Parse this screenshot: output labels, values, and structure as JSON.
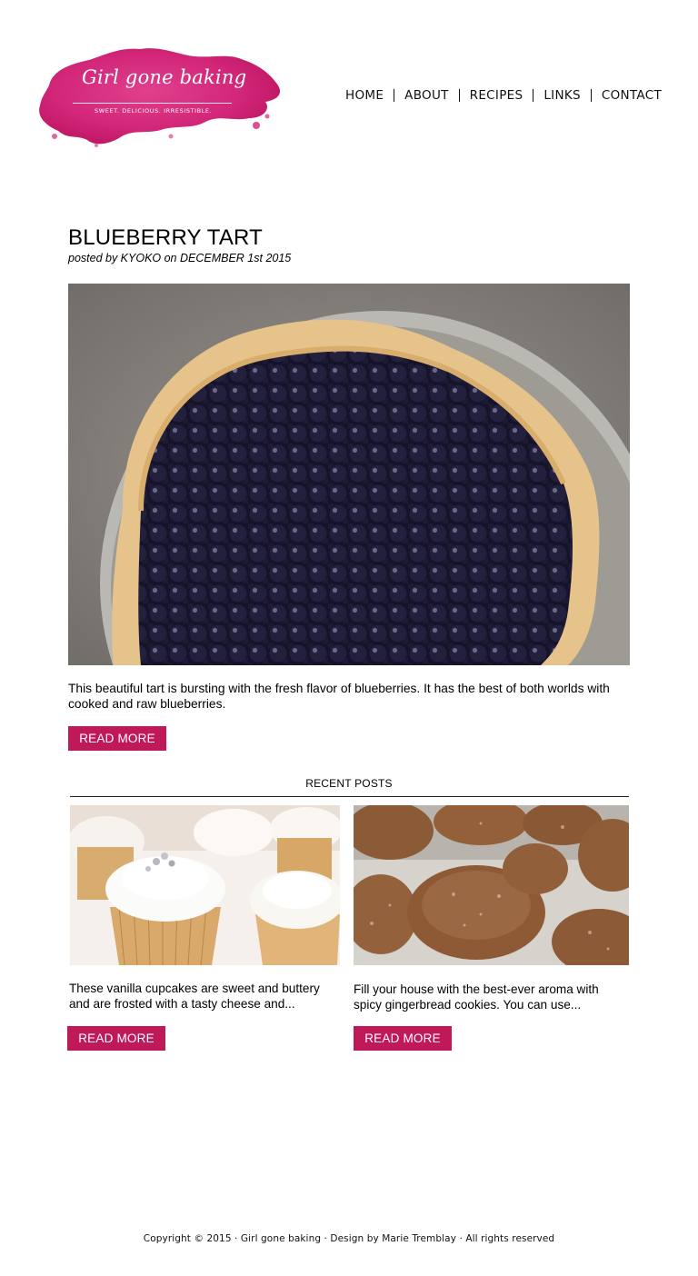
{
  "brand": {
    "name": "Girl gone baking",
    "tagline": "SWEET. DELICIOUS. IRRESISTIBLE.",
    "accent_color": "#c0195a"
  },
  "nav": {
    "items": [
      {
        "label": "HOME"
      },
      {
        "label": "ABOUT"
      },
      {
        "label": "RECIPES"
      },
      {
        "label": "LINKS"
      },
      {
        "label": "CONTACT"
      }
    ]
  },
  "post": {
    "title": "BLUEBERRY TART",
    "meta": "posted by KYOKO on DECEMBER 1st 2015",
    "image": "blueberry-tart-photo",
    "excerpt": "This beautiful tart is bursting with the fresh flavor of blueberries. It has the best of both worlds with cooked and raw blueberries.",
    "read_more_label": "READ MORE"
  },
  "recent": {
    "heading": "RECENT POSTS",
    "cards": [
      {
        "image": "vanilla-cupcakes-photo",
        "excerpt": "These vanilla cupcakes are sweet and buttery and are frosted with a tasty cheese and...",
        "read_more_label": "READ MORE"
      },
      {
        "image": "gingerbread-cookies-photo",
        "excerpt": "Fill your house with the best-ever aroma with spicy gingerbread cookies. You can use...",
        "read_more_label": "READ MORE"
      }
    ]
  },
  "footer": {
    "text": "Copyright © 2015 · Girl gone baking · Design by Marie Tremblay · All rights reserved"
  }
}
